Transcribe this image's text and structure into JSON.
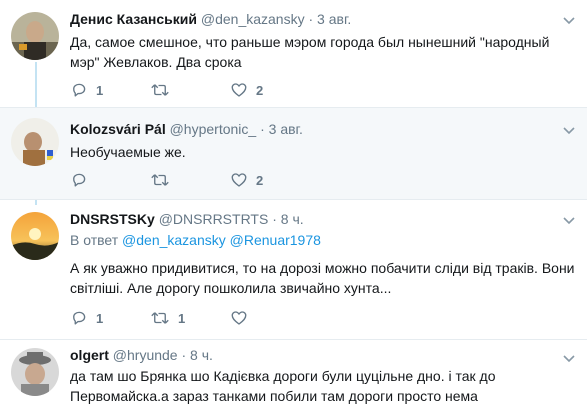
{
  "tweets": [
    {
      "name": "Денис Казанський",
      "handle": "@den_kazansky",
      "time": "3 авг.",
      "text": "Да, самое смешное, что раньше мэром города был нынешний \"народный мэр\" Жевлаков. Два срока",
      "replies": "1",
      "retweets": "",
      "likes": "2"
    },
    {
      "name": "Kolozsvári Pál",
      "handle": "@hypertonic_",
      "time": "3 авг.",
      "text": "Необучаемые же.",
      "replies": "",
      "retweets": "",
      "likes": "2"
    },
    {
      "name": "DNSRSTSKy",
      "handle": "@DNSRRSTRTS",
      "time": "8 ч.",
      "reply_prefix": "В ответ",
      "reply_user1": "@den_kazansky",
      "reply_user2": "@Renuar1978",
      "text": "А як уважно придивитися, то на дорозі можно побачити сліди від траків. Вони світліші. Але дорогу пошколила звичайно хунта...",
      "replies": "1",
      "retweets": "1",
      "likes": ""
    },
    {
      "name": "olgert",
      "handle": "@hryunde",
      "time": "8 ч.",
      "text": "да там шо Брянка шо Кадієвка дороги були цуцільне дно. і так до Первомайска.а зараз танками побили там дороги просто нема"
    }
  ],
  "separator": "·",
  "colors": {
    "name": "#14171a",
    "secondary": "#657786",
    "link": "#1b95e0",
    "highlight_bg": "#f5f8fa",
    "thread_line": "#c4e3f3"
  },
  "icons": [
    "reply-icon",
    "retweet-icon",
    "like-icon",
    "chevron-down-icon"
  ]
}
